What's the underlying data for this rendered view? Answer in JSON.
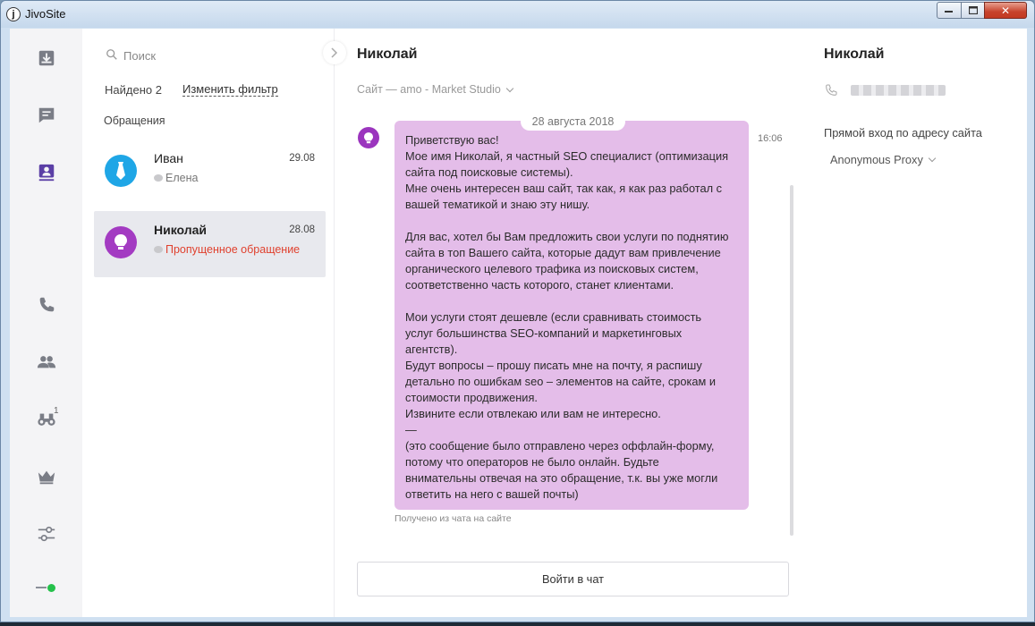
{
  "window": {
    "title": "JivoSite",
    "close_glyph": "✕",
    "logo_glyph": "j"
  },
  "nav": {
    "icons": [
      "inbox-icon",
      "chat-icon",
      "visitors-icon",
      "phone-icon",
      "team-icon",
      "binoculars-icon",
      "crown-icon",
      "settings-sliders-icon"
    ],
    "binoculars_badge": "1",
    "status_color": "#25c14b"
  },
  "list": {
    "search_placeholder": "Поиск",
    "found": "Найдено 2",
    "change_filter": "Изменить фильтр",
    "section": "Обращения",
    "items": [
      {
        "name": "Иван",
        "date": "29.08",
        "sub": "Елена",
        "avatar_color": "#1fa6e6"
      },
      {
        "name": "Николай",
        "date": "28.08",
        "sub": "Пропущенное обращение",
        "avatar_color": "#a33bc2"
      }
    ]
  },
  "chat": {
    "title": "Николай",
    "source": "Сайт — amo - Market Studio",
    "date_pill": "28 августа 2018",
    "time": "16:06",
    "message_lines": [
      "Приветствую вас!",
      "Мое имя Николай, я частный SEO специалист (оптимизация",
      "сайта под поисковые системы).",
      "Мне очень интересен ваш сайт, так как, я как раз работал с",
      "вашей тематикой и знаю эту нишу.",
      "",
      "Для вас, хотел бы Вам предложить свои услуги по поднятию",
      "сайта в топ Вашего сайта, которые дадут вам привлечение",
      "органического целевого трафика из поисковых систем,",
      "соответственно часть которого, станет клиентами.",
      "",
      "Мои услуги стоят дешевле (если сравнивать стоимость",
      "услуг большинства SEO-компаний и маркетинговых",
      "агентств).",
      "Будут вопросы – прошу писать мне на почту, я распишу",
      "детально по ошибкам seo – элементов на сайте, срокам и",
      "стоимости продвижения.",
      "Извините если отвлекаю или вам не интересно.",
      "—",
      "(это сообщение было отправлено через оффлайн-форму,",
      "потому что операторов не было онлайн. Будьте",
      "внимательны отвечая на это обращение, т.к. вы уже могли",
      "ответить на него с вашей почты)"
    ],
    "meta": "Получено из чата на сайте",
    "join_button": "Войти в чат",
    "bubble_color": "#e4bde9"
  },
  "info": {
    "name": "Николай",
    "entry_label": "Прямой вход по адресу сайта",
    "proxy": "Anonymous Proxy"
  }
}
